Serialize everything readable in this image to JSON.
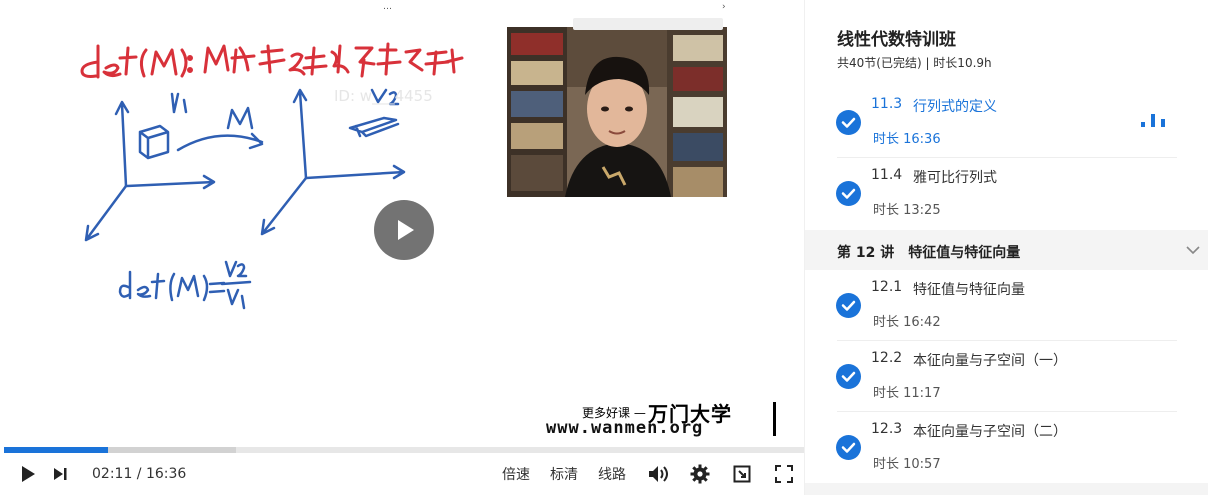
{
  "video": {
    "watermark": "ID: w___4455",
    "brand": {
      "more_courses": "更多好课 —",
      "name": "万门大学",
      "url": "www.wanmen.org"
    },
    "progress": {
      "played_fraction": 0.13,
      "buffered_fraction": 0.29
    },
    "controls": {
      "time": "02:11 / 16:36",
      "speed_label": "倍速",
      "quality_label": "标清",
      "route_label": "线路"
    },
    "colors": {
      "accent": "#1a73d9",
      "ink_red": "#d8313a",
      "ink_blue": "#2f5fb3"
    }
  },
  "course": {
    "title": "线性代数特训班",
    "meta": "共40节(已完结) | 时长10.9h",
    "lessons_top": [
      {
        "num": "11.3",
        "title": "行列式的定义",
        "duration": "时长 16:36",
        "active": true
      },
      {
        "num": "11.4",
        "title": "雅可比行列式",
        "duration": "时长 13:25",
        "active": false
      }
    ],
    "chapter": "第 12 讲　特征值与特征向量",
    "lessons_bottom": [
      {
        "num": "12.1",
        "title": "特征值与特征向量",
        "duration": "时长 16:42"
      },
      {
        "num": "12.2",
        "title": "本征向量与子空间（一）",
        "duration": "时长 11:17"
      },
      {
        "num": "12.3",
        "title": "本征向量与子空间（二）",
        "duration": "时长 10:57"
      }
    ]
  }
}
